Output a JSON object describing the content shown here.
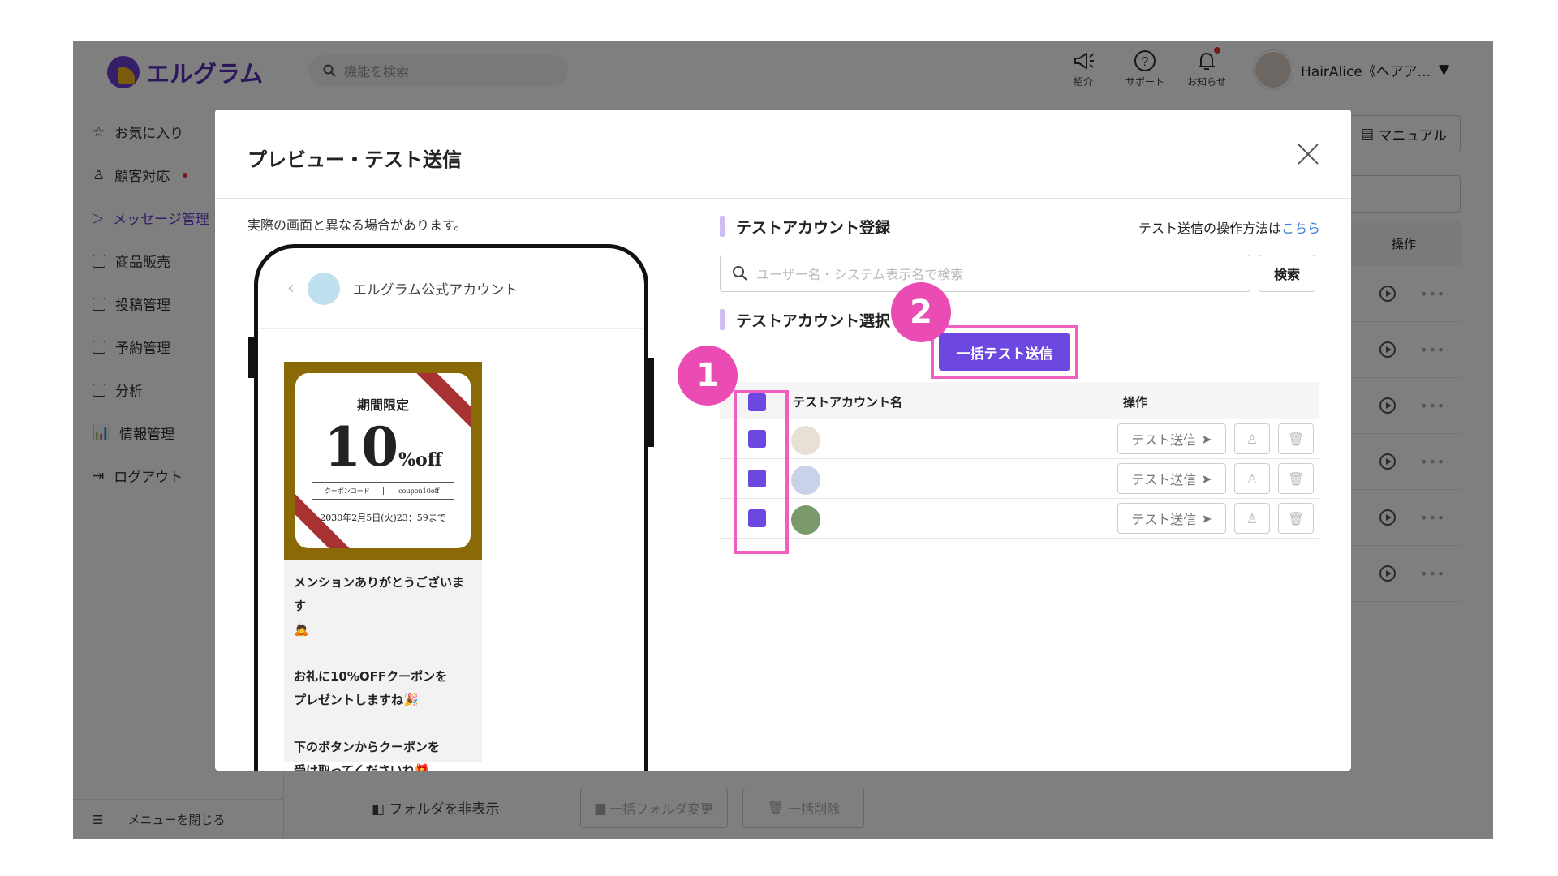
{
  "app": {
    "logo_text": "エルグラム",
    "search_placeholder": "機能を検索",
    "top_icons": [
      {
        "icon": "megaphone-icon",
        "label": "紹介"
      },
      {
        "icon": "help-icon",
        "label": "サポート"
      },
      {
        "icon": "bell-icon",
        "label": "お知らせ"
      }
    ],
    "profile_name": "HairAlice《ヘアア...",
    "sidebar": [
      {
        "label": "お気に入り",
        "icon": "star-icon"
      },
      {
        "label": "顧客対応",
        "icon": "user-icon",
        "dot": true
      },
      {
        "label": "メッセージ管理",
        "icon": "send-icon",
        "active": true
      },
      {
        "label": "商品販売",
        "icon": "store-icon"
      },
      {
        "label": "投稿管理",
        "icon": "edit-icon"
      },
      {
        "label": "予約管理",
        "icon": "calendar-icon"
      },
      {
        "label": "分析",
        "icon": "report-icon"
      },
      {
        "label": "情報管理",
        "icon": "chart-icon"
      },
      {
        "label": "ログアウト",
        "icon": "logout-icon"
      }
    ],
    "close_menu": "メニューを閉じる",
    "manual_btn": "マニュアル",
    "ops_header": "操作",
    "folder_toggle": "フォルダを非表示",
    "bulk_folder_btn": "一括フォルダ変更",
    "bulk_delete_btn": "一括削除"
  },
  "modal": {
    "title": "プレビュー・テスト送信",
    "note": "実際の画面と異なる場合があります。",
    "phone": {
      "account_name": "エルグラム公式アカウント",
      "coupon": {
        "label": "期間限定",
        "big": "10",
        "suffix": "%off",
        "code_label": "クーポンコード",
        "code_value": "coupon10off",
        "expiry": "2030年2月5日(火)23：59まで"
      },
      "message_lines": [
        "メンションありがとうございます",
        "🙇",
        "",
        "お礼に10%OFFクーポンを",
        "プレゼントしますね🎉",
        "",
        "下のボタンからクーポンを",
        "受け取ってくださいね🎁"
      ]
    },
    "register_title": "テストアカウント登録",
    "howto_text": "テスト送信の操作方法は",
    "howto_link": "こちら",
    "search_placeholder": "ユーザー名・システム表示名で検索",
    "search_btn": "検索",
    "select_title": "テストアカウント選択",
    "bulk_send_btn": "一括テスト送信",
    "table_headers": {
      "name": "テストアカウント名",
      "ops": "操作"
    },
    "rows": [
      {
        "test_btn": "テスト送信",
        "avatar_color": "#e8dfd6"
      },
      {
        "test_btn": "テスト送信",
        "avatar_color": "#c8d2e8"
      },
      {
        "test_btn": "テスト送信",
        "avatar_color": "#7a9a6e"
      }
    ],
    "badges": [
      "1",
      "2"
    ]
  },
  "colors": {
    "accent": "#6c47e0",
    "highlight": "#ef5fbf"
  }
}
